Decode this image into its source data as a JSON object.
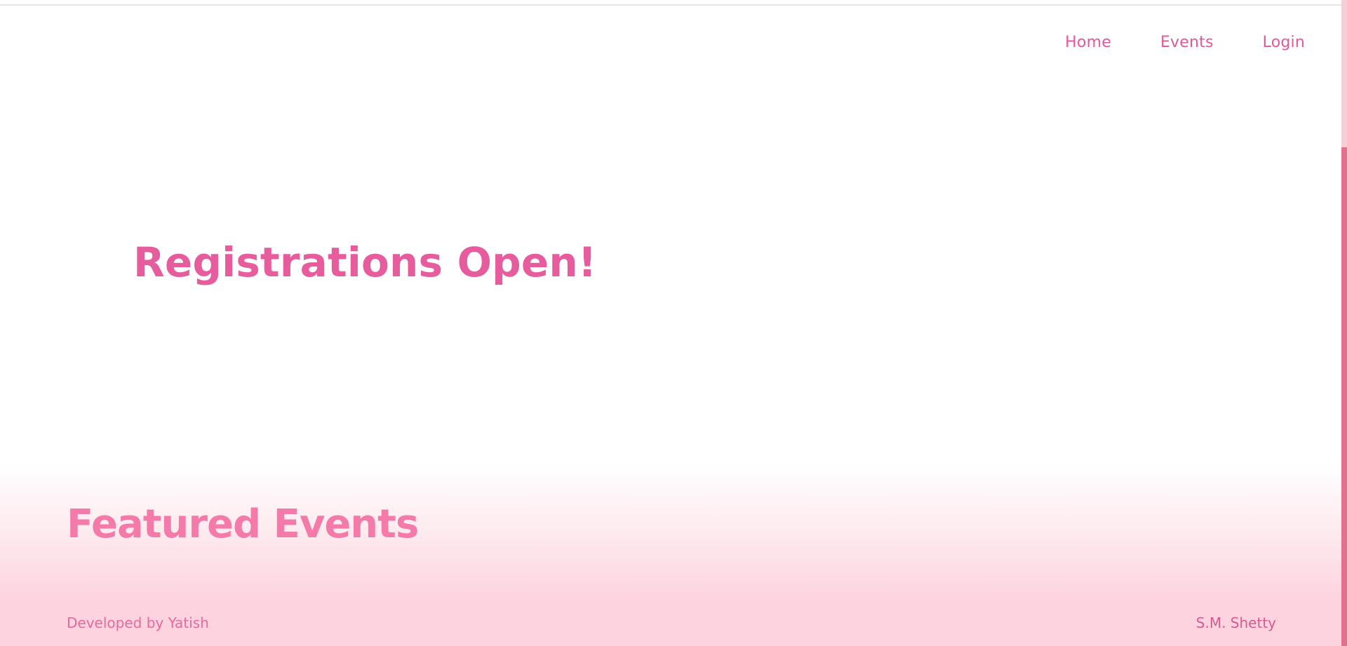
{
  "nav": {
    "items": [
      {
        "label": "Home"
      },
      {
        "label": "Events"
      },
      {
        "label": "Login"
      }
    ]
  },
  "hero": {
    "title": "Registrations Open!"
  },
  "featured": {
    "title": "Featured Events"
  },
  "footer": {
    "left_text": "Developed by Yatish",
    "right_text": "S.M. Shetty"
  },
  "colors": {
    "accent_pink": "#e65c9c",
    "featured_pink": "#f47aaa",
    "band_pink": "#fdd3df",
    "scrollbar_thumb": "#e4708f"
  }
}
